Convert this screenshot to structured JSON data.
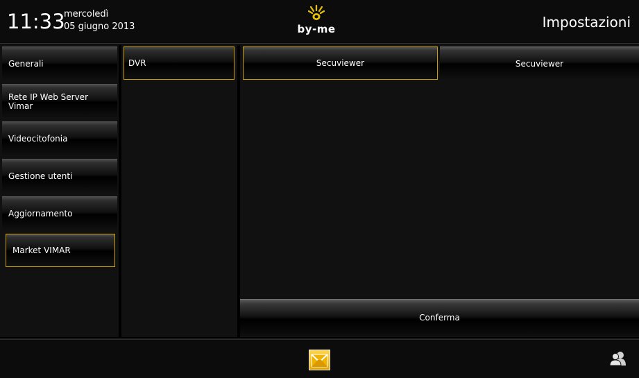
{
  "header": {
    "time": "11:33",
    "day": "mercoledì",
    "date": "05 giugno 2013",
    "logo_text": "by-me",
    "title": "Impostazioni",
    "logo_icon": "by-me-sun-logo-icon"
  },
  "sidebar": {
    "items": [
      {
        "label": "Generali",
        "selected": false
      },
      {
        "label": "Rete IP Web Server Vimar",
        "selected": false
      },
      {
        "label": "Videocitofonia",
        "selected": false
      },
      {
        "label": "Gestione utenti",
        "selected": false
      },
      {
        "label": "Aggiornamento",
        "selected": false
      },
      {
        "label": "Market VIMAR",
        "selected": true
      }
    ]
  },
  "submenu": {
    "items": [
      {
        "label": "DVR",
        "selected": true
      }
    ]
  },
  "main": {
    "tabs": [
      {
        "label": "Secuviewer",
        "selected": true
      },
      {
        "label": "Secuviewer",
        "selected": false
      }
    ],
    "confirm_label": "Conferma"
  },
  "footer": {
    "home_icon": "home-envelope-icon",
    "users_icon": "users-icon"
  },
  "colors": {
    "accent": "#c8a000",
    "background": "#000000",
    "panel": "#111111"
  }
}
